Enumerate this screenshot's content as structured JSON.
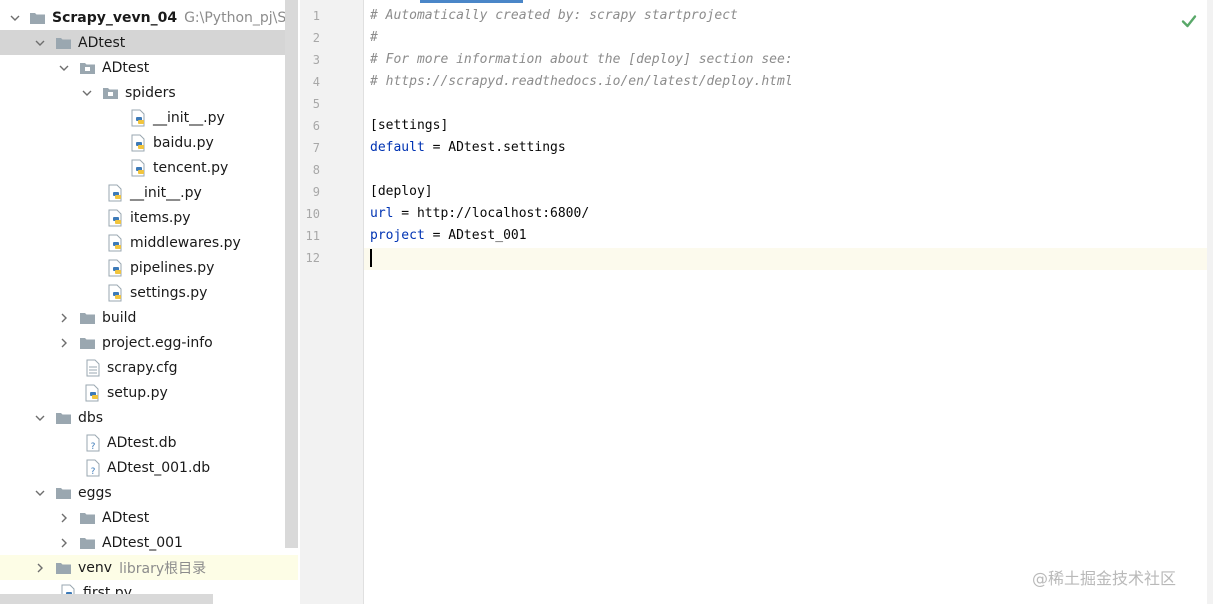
{
  "project_tree": {
    "items": [
      {
        "label": "Scrapy_vevn_04",
        "hint": "G:\\Python_pj\\Scrap",
        "icon": "folder-icon",
        "expanded": true,
        "bold": true
      },
      {
        "label": "ADtest",
        "icon": "folder-icon",
        "expanded": true,
        "selected": true
      },
      {
        "label": "ADtest",
        "icon": "package-folder-icon",
        "expanded": true
      },
      {
        "label": "spiders",
        "icon": "package-folder-icon",
        "expanded": true
      },
      {
        "label": "__init__.py",
        "icon": "python-file-icon"
      },
      {
        "label": "baidu.py",
        "icon": "python-file-icon"
      },
      {
        "label": "tencent.py",
        "icon": "python-file-icon"
      },
      {
        "label": "__init__.py",
        "icon": "python-file-icon"
      },
      {
        "label": "items.py",
        "icon": "python-file-icon"
      },
      {
        "label": "middlewares.py",
        "icon": "python-file-icon"
      },
      {
        "label": "pipelines.py",
        "icon": "python-file-icon"
      },
      {
        "label": "settings.py",
        "icon": "python-file-icon"
      },
      {
        "label": "build",
        "icon": "folder-icon",
        "expanded": false
      },
      {
        "label": "project.egg-info",
        "icon": "folder-icon",
        "expanded": false
      },
      {
        "label": "scrapy.cfg",
        "icon": "text-file-icon"
      },
      {
        "label": "setup.py",
        "icon": "python-file-icon"
      },
      {
        "label": "dbs",
        "icon": "folder-icon",
        "expanded": true
      },
      {
        "label": "ADtest.db",
        "icon": "unknown-file-icon"
      },
      {
        "label": "ADtest_001.db",
        "icon": "unknown-file-icon"
      },
      {
        "label": "eggs",
        "icon": "folder-icon",
        "expanded": true
      },
      {
        "label": "ADtest",
        "icon": "folder-icon",
        "expanded": false
      },
      {
        "label": "ADtest_001",
        "icon": "folder-icon",
        "expanded": false
      },
      {
        "label": "venv",
        "hint": "library根目录",
        "icon": "folder-icon",
        "expanded": false
      },
      {
        "label": "first.py",
        "icon": "python-file-icon"
      }
    ]
  },
  "editor": {
    "line_numbers": [
      "1",
      "2",
      "3",
      "4",
      "5",
      "6",
      "7",
      "8",
      "9",
      "10",
      "11",
      "12"
    ],
    "lines": [
      {
        "comment": "# Automatically created by: scrapy startproject"
      },
      {
        "comment": "#"
      },
      {
        "comment": "# For more information about the [deploy] section see:"
      },
      {
        "comment": "# https://scrapyd.readthedocs.io/en/latest/deploy.html"
      },
      {},
      {
        "text": "[settings]"
      },
      {
        "key": "default",
        "eq": " = ",
        "value": "ADtest.settings"
      },
      {},
      {
        "text": "[deploy]"
      },
      {
        "key": "url",
        "eq": " = ",
        "value": "http://localhost:6800/"
      },
      {
        "key": "project",
        "eq": " = ",
        "value": "ADtest_001"
      },
      {}
    ],
    "current_line": "12",
    "status_icon": "checkmark-icon"
  },
  "watermark": "@稀土掘金技术社区",
  "colors": {
    "selection": "#d5d5d5",
    "current_line": "#fcfaed",
    "keyword": "#0033b3",
    "comment": "#8c8c8c",
    "check": "#59a869"
  }
}
